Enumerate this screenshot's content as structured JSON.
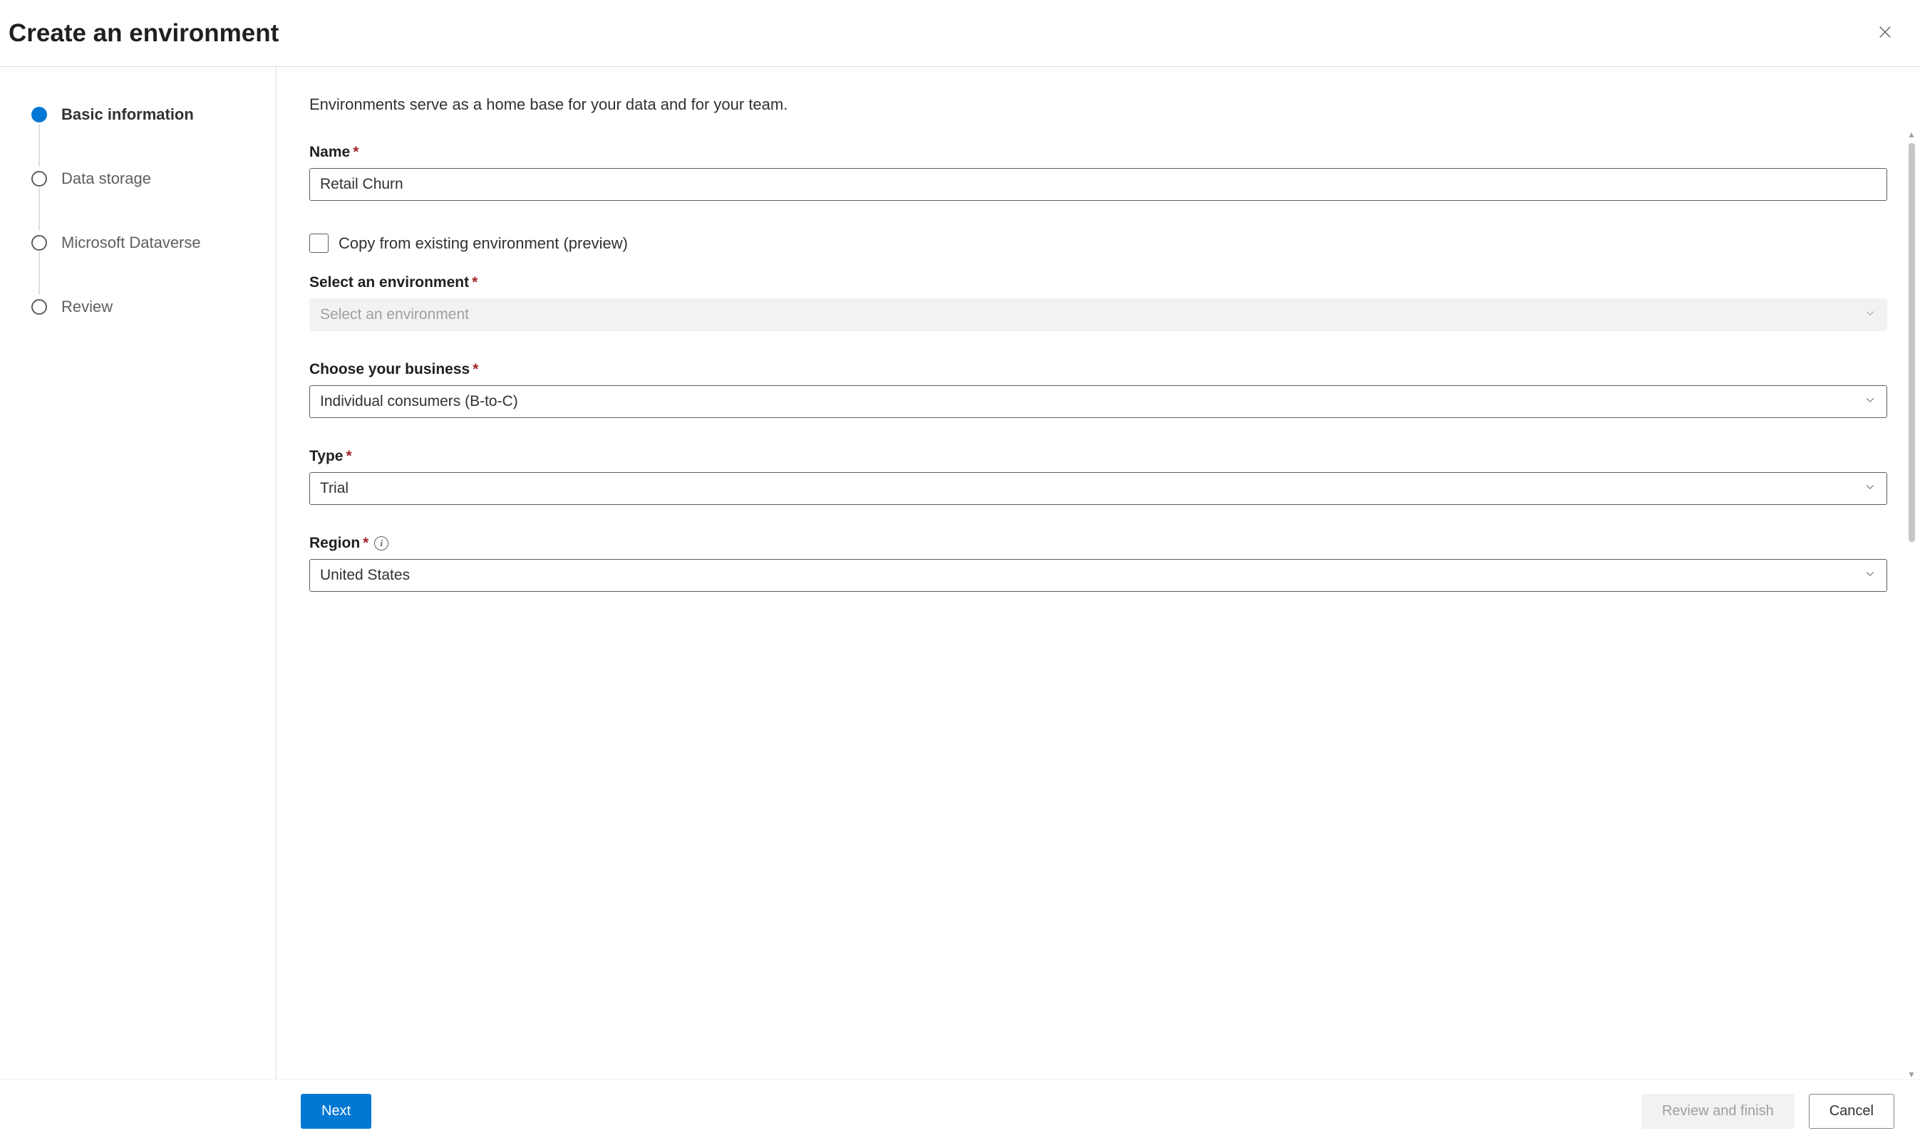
{
  "header": {
    "title": "Create an environment"
  },
  "sidebar": {
    "steps": [
      {
        "label": "Basic information",
        "active": true
      },
      {
        "label": "Data storage",
        "active": false
      },
      {
        "label": "Microsoft Dataverse",
        "active": false
      },
      {
        "label": "Review",
        "active": false
      }
    ]
  },
  "main": {
    "heading": "Basic information",
    "subtext": "Environments serve as a home base for your data and for your team.",
    "name_label": "Name",
    "name_value": "Retail Churn",
    "copy_checkbox_label": "Copy from existing environment (preview)",
    "select_env_label": "Select an environment",
    "select_env_placeholder": "Select an environment",
    "business_label": "Choose your business",
    "business_value": "Individual consumers (B-to-C)",
    "type_label": "Type",
    "type_value": "Trial",
    "region_label": "Region",
    "region_value": "United States"
  },
  "footer": {
    "next": "Next",
    "review": "Review and finish",
    "cancel": "Cancel"
  }
}
